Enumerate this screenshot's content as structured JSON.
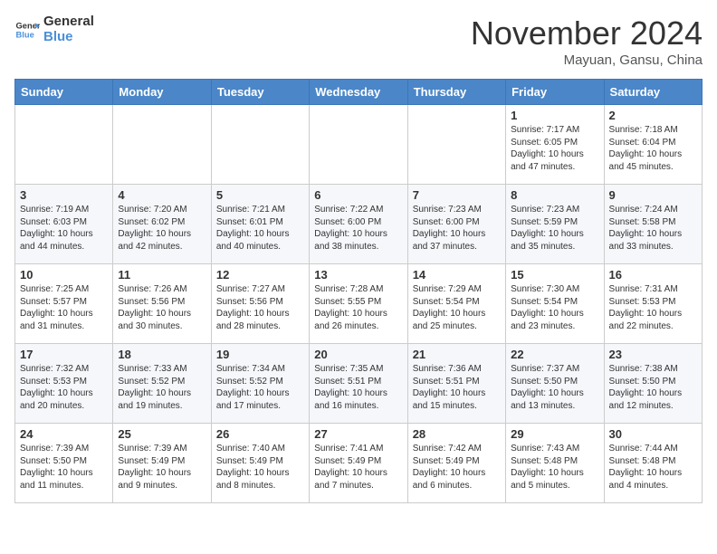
{
  "header": {
    "logo_line1": "General",
    "logo_line2": "Blue",
    "month_title": "November 2024",
    "location": "Mayuan, Gansu, China"
  },
  "weekdays": [
    "Sunday",
    "Monday",
    "Tuesday",
    "Wednesday",
    "Thursday",
    "Friday",
    "Saturday"
  ],
  "weeks": [
    [
      {
        "day": "",
        "text": ""
      },
      {
        "day": "",
        "text": ""
      },
      {
        "day": "",
        "text": ""
      },
      {
        "day": "",
        "text": ""
      },
      {
        "day": "",
        "text": ""
      },
      {
        "day": "1",
        "text": "Sunrise: 7:17 AM\nSunset: 6:05 PM\nDaylight: 10 hours and 47 minutes."
      },
      {
        "day": "2",
        "text": "Sunrise: 7:18 AM\nSunset: 6:04 PM\nDaylight: 10 hours and 45 minutes."
      }
    ],
    [
      {
        "day": "3",
        "text": "Sunrise: 7:19 AM\nSunset: 6:03 PM\nDaylight: 10 hours and 44 minutes."
      },
      {
        "day": "4",
        "text": "Sunrise: 7:20 AM\nSunset: 6:02 PM\nDaylight: 10 hours and 42 minutes."
      },
      {
        "day": "5",
        "text": "Sunrise: 7:21 AM\nSunset: 6:01 PM\nDaylight: 10 hours and 40 minutes."
      },
      {
        "day": "6",
        "text": "Sunrise: 7:22 AM\nSunset: 6:00 PM\nDaylight: 10 hours and 38 minutes."
      },
      {
        "day": "7",
        "text": "Sunrise: 7:23 AM\nSunset: 6:00 PM\nDaylight: 10 hours and 37 minutes."
      },
      {
        "day": "8",
        "text": "Sunrise: 7:23 AM\nSunset: 5:59 PM\nDaylight: 10 hours and 35 minutes."
      },
      {
        "day": "9",
        "text": "Sunrise: 7:24 AM\nSunset: 5:58 PM\nDaylight: 10 hours and 33 minutes."
      }
    ],
    [
      {
        "day": "10",
        "text": "Sunrise: 7:25 AM\nSunset: 5:57 PM\nDaylight: 10 hours and 31 minutes."
      },
      {
        "day": "11",
        "text": "Sunrise: 7:26 AM\nSunset: 5:56 PM\nDaylight: 10 hours and 30 minutes."
      },
      {
        "day": "12",
        "text": "Sunrise: 7:27 AM\nSunset: 5:56 PM\nDaylight: 10 hours and 28 minutes."
      },
      {
        "day": "13",
        "text": "Sunrise: 7:28 AM\nSunset: 5:55 PM\nDaylight: 10 hours and 26 minutes."
      },
      {
        "day": "14",
        "text": "Sunrise: 7:29 AM\nSunset: 5:54 PM\nDaylight: 10 hours and 25 minutes."
      },
      {
        "day": "15",
        "text": "Sunrise: 7:30 AM\nSunset: 5:54 PM\nDaylight: 10 hours and 23 minutes."
      },
      {
        "day": "16",
        "text": "Sunrise: 7:31 AM\nSunset: 5:53 PM\nDaylight: 10 hours and 22 minutes."
      }
    ],
    [
      {
        "day": "17",
        "text": "Sunrise: 7:32 AM\nSunset: 5:53 PM\nDaylight: 10 hours and 20 minutes."
      },
      {
        "day": "18",
        "text": "Sunrise: 7:33 AM\nSunset: 5:52 PM\nDaylight: 10 hours and 19 minutes."
      },
      {
        "day": "19",
        "text": "Sunrise: 7:34 AM\nSunset: 5:52 PM\nDaylight: 10 hours and 17 minutes."
      },
      {
        "day": "20",
        "text": "Sunrise: 7:35 AM\nSunset: 5:51 PM\nDaylight: 10 hours and 16 minutes."
      },
      {
        "day": "21",
        "text": "Sunrise: 7:36 AM\nSunset: 5:51 PM\nDaylight: 10 hours and 15 minutes."
      },
      {
        "day": "22",
        "text": "Sunrise: 7:37 AM\nSunset: 5:50 PM\nDaylight: 10 hours and 13 minutes."
      },
      {
        "day": "23",
        "text": "Sunrise: 7:38 AM\nSunset: 5:50 PM\nDaylight: 10 hours and 12 minutes."
      }
    ],
    [
      {
        "day": "24",
        "text": "Sunrise: 7:39 AM\nSunset: 5:50 PM\nDaylight: 10 hours and 11 minutes."
      },
      {
        "day": "25",
        "text": "Sunrise: 7:39 AM\nSunset: 5:49 PM\nDaylight: 10 hours and 9 minutes."
      },
      {
        "day": "26",
        "text": "Sunrise: 7:40 AM\nSunset: 5:49 PM\nDaylight: 10 hours and 8 minutes."
      },
      {
        "day": "27",
        "text": "Sunrise: 7:41 AM\nSunset: 5:49 PM\nDaylight: 10 hours and 7 minutes."
      },
      {
        "day": "28",
        "text": "Sunrise: 7:42 AM\nSunset: 5:49 PM\nDaylight: 10 hours and 6 minutes."
      },
      {
        "day": "29",
        "text": "Sunrise: 7:43 AM\nSunset: 5:48 PM\nDaylight: 10 hours and 5 minutes."
      },
      {
        "day": "30",
        "text": "Sunrise: 7:44 AM\nSunset: 5:48 PM\nDaylight: 10 hours and 4 minutes."
      }
    ]
  ]
}
